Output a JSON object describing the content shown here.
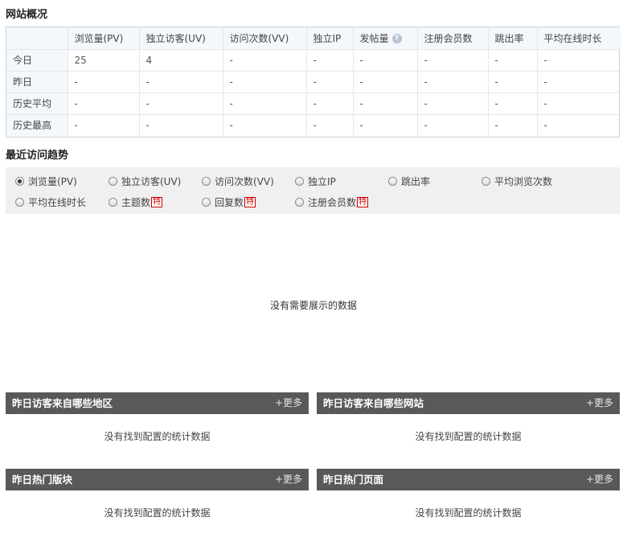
{
  "overview": {
    "title": "网站概况",
    "columns": [
      "",
      "浏览量(PV)",
      "独立访客(UV)",
      "访问次数(VV)",
      "独立IP",
      "发帖量",
      "注册会员数",
      "跳出率",
      "平均在线时长"
    ],
    "help_icon": "question-circle-icon",
    "rows": [
      {
        "label": "今日",
        "values": [
          "25",
          "4",
          "-",
          "-",
          "-",
          "-",
          "-",
          "-"
        ]
      },
      {
        "label": "昨日",
        "values": [
          "-",
          "-",
          "-",
          "-",
          "-",
          "-",
          "-",
          "-"
        ]
      },
      {
        "label": "历史平均",
        "values": [
          "-",
          "-",
          "-",
          "-",
          "-",
          "-",
          "-",
          "-"
        ]
      },
      {
        "label": "历史最高",
        "values": [
          "-",
          "-",
          "-",
          "-",
          "-",
          "-",
          "-",
          "-"
        ]
      }
    ]
  },
  "trend": {
    "title": "最近访问趋势",
    "options": [
      {
        "label": "浏览量(PV)",
        "checked": true,
        "tag": ""
      },
      {
        "label": "独立访客(UV)",
        "checked": false,
        "tag": ""
      },
      {
        "label": "访问次数(VV)",
        "checked": false,
        "tag": ""
      },
      {
        "label": "独立IP",
        "checked": false,
        "tag": ""
      },
      {
        "label": "跳出率",
        "checked": false,
        "tag": ""
      },
      {
        "label": "平均浏览次数",
        "checked": false,
        "tag": ""
      },
      {
        "label": "平均在线时长",
        "checked": false,
        "tag": ""
      },
      {
        "label": "主题数",
        "checked": false,
        "tag": "特"
      },
      {
        "label": "回复数",
        "checked": false,
        "tag": "特"
      },
      {
        "label": "注册会员数",
        "checked": false,
        "tag": "特"
      }
    ],
    "empty_text": "没有需要展示的数据"
  },
  "panels": {
    "regions": {
      "title": "昨日访客来自哪些地区",
      "more": "+更多",
      "empty_text": "没有找到配置的统计数据"
    },
    "sites": {
      "title": "昨日访客来自哪些网站",
      "more": "+更多",
      "empty_text": "没有找到配置的统计数据"
    },
    "forums": {
      "title": "昨日热门版块",
      "more": "+更多",
      "empty_text": "没有找到配置的统计数据"
    },
    "pages": {
      "title": "昨日热门页面",
      "more": "+更多",
      "empty_text": "没有找到配置的统计数据"
    }
  },
  "colors": {
    "panel_header": "#595959",
    "tag_red": "#cc0000",
    "options_bg": "#f0f0f0"
  }
}
